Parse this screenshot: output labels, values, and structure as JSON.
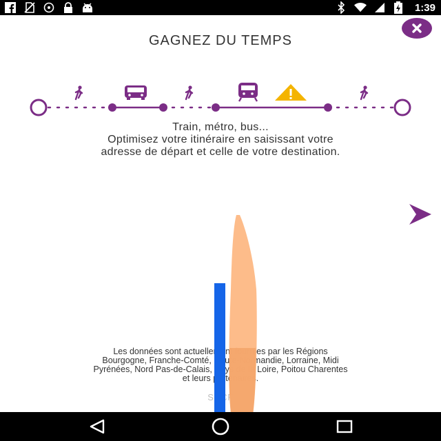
{
  "status_bar": {
    "time": "1:39",
    "left_icons": [
      "facebook-icon",
      "no-sim-icon",
      "alarm-icon",
      "lock-icon",
      "android-icon"
    ],
    "right_icons": [
      "bluetooth-icon",
      "wifi-icon",
      "signal-icon",
      "battery-icon"
    ]
  },
  "header": {
    "title": "GAGNEZ DU TEMPS"
  },
  "description": {
    "line1": "Train, métro, bus...",
    "line2": "Optimisez votre itinéraire en saisissant votre",
    "line3": "adresse de départ et celle de votre destination."
  },
  "footer": {
    "line1": "Les données sont actuellement fournies par les Régions",
    "line2": "Bourgogne, Franche-Comté, Haute-Normandie, Lorraine, Midi",
    "line3": "Pyrénées, Nord Pas-de-Calais, Pays de la Loire, Poitou Charentes",
    "line4": "et leurs partenaires."
  },
  "skip_label": "SNCF",
  "colors": {
    "accent": "#7b2d86",
    "warning": "#f4b400",
    "status_bar": "#000000",
    "background": "#ffffff"
  },
  "journey_icons": [
    "walk-icon",
    "bus-icon",
    "walk-icon",
    "train-icon",
    "warning-icon",
    "walk-icon"
  ],
  "nav_bar": {
    "buttons": [
      "back-icon",
      "home-icon",
      "recents-icon"
    ]
  }
}
